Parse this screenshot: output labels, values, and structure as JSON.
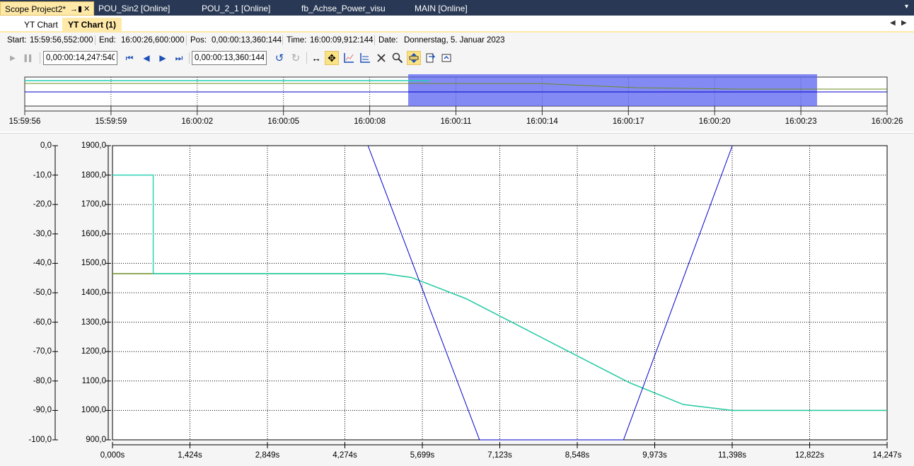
{
  "doc_tabs": [
    {
      "label": "Scope Project2*",
      "active": true
    },
    {
      "label": "POU_Sin2 [Online]",
      "active": false
    },
    {
      "label": "POU_2_1 [Online]",
      "active": false
    },
    {
      "label": "fb_Achse_Power_visu",
      "active": false
    },
    {
      "label": "MAIN [Online]",
      "active": false
    }
  ],
  "doc_tab_icons": {
    "pin": "→▮",
    "close": "✕",
    "menu": "▾"
  },
  "sub_tabs": [
    {
      "label": "YT Chart",
      "active": false
    },
    {
      "label": "YT Chart (1)",
      "active": true
    }
  ],
  "sub_tab_scroll": {
    "left": "◀",
    "right": "▶"
  },
  "info": {
    "start_label": "Start:",
    "start_value": "15:59:56,552:000",
    "end_label": "End:",
    "end_value": "16:00:26,600:000",
    "pos_label": "Pos:",
    "pos_value": "0,00:00:13,360:144",
    "time_label": "Time:",
    "time_value": "16:00:09,912:144",
    "date_label": "Date:",
    "date_value": "Donnerstag, 5. Januar 2023"
  },
  "toolbar": {
    "play_icon": "▶",
    "pause_icon": "▌▌",
    "timespan_value": "0,00:00:14,247:540",
    "first_icon": "⏮",
    "prev_icon": "◀",
    "next_icon": "▶",
    "last_icon": "⏭",
    "position_value": "0,00:00:13,360:144",
    "undo_icon": "↺",
    "redo_icon": "↻",
    "pan_icon": "↔",
    "move_icon": "✥",
    "icons": [
      "chart-icon",
      "chart-icon",
      "chart-icon",
      "cursor-icon",
      "zoom-icon",
      "zoom-icon",
      "export-icon",
      "export-icon"
    ]
  },
  "colors": {
    "accent": "#ffe9a8",
    "tab_strip": "#293955",
    "series_blue": "#0000cc",
    "series_cyan": "#1fd1b0",
    "series_olive": "#6b8e23",
    "series_dark_green": "#2e5e2e",
    "overview_selection": "#5b63f0"
  },
  "overview": {
    "tick_labels": [
      "15:59:56",
      "15:59:59",
      "16:00:02",
      "16:00:05",
      "16:00:08",
      "16:00:11",
      "16:00:14",
      "16:00:17",
      "16:00:20",
      "16:00:23",
      "16:00:26"
    ]
  },
  "chart_data": {
    "type": "line",
    "title": "",
    "xlabel": "",
    "x_tick_labels": [
      "0,000s",
      "1,424s",
      "2,849s",
      "4,274s",
      "5,699s",
      "7,123s",
      "8,548s",
      "9,973s",
      "11,398s",
      "12,822s",
      "14,247s"
    ],
    "xlim": [
      0,
      14.2475
    ],
    "y_axes": [
      {
        "tick_labels": [
          "0,0",
          "-10,0",
          "-20,0",
          "-30,0",
          "-40,0",
          "-50,0",
          "-60,0",
          "-70,0",
          "-80,0",
          "-90,0",
          "-100,0"
        ],
        "ylim": [
          -100,
          0
        ]
      },
      {
        "tick_labels": [
          "1900,0",
          "1800,0",
          "1700,0",
          "1600,0",
          "1500,0",
          "1400,0",
          "1300,0",
          "1200,0",
          "1100,0",
          "1000,0",
          "900,0"
        ],
        "ylim": [
          900,
          1900
        ]
      }
    ],
    "grid": true,
    "series": [
      {
        "axis": 0,
        "color": "#1fd1b0",
        "x": [
          0,
          0.75,
          0.75,
          5.0,
          5.5,
          6.5,
          7.5,
          8.5,
          9.5,
          10.5,
          11.4,
          14.2475
        ],
        "y": [
          -10,
          -10,
          -43.5,
          -43.5,
          -44.8,
          -52,
          -61.5,
          -71,
          -80.5,
          -88,
          -90,
          -90
        ]
      },
      {
        "axis": 0,
        "color": "#6b8e23",
        "x": [
          0,
          5.0,
          5.5,
          6.5,
          7.5,
          8.5,
          9.5,
          10.5,
          11.4,
          14.2475
        ],
        "y": [
          -43.5,
          -43.5,
          -44.8,
          -52,
          -61.5,
          -71,
          -80.5,
          -88,
          -90,
          -90
        ]
      },
      {
        "axis": 1,
        "color": "#0000cc",
        "x": [
          4.7,
          6.75,
          9.4,
          11.4
        ],
        "y": [
          1900,
          900,
          900,
          1900
        ]
      }
    ]
  }
}
